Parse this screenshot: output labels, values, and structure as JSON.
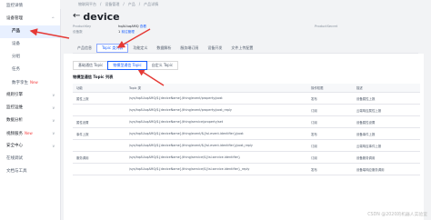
{
  "sidebar": {
    "items": [
      {
        "label": "监控详情",
        "kind": "item"
      },
      {
        "label": "设备管理",
        "kind": "group",
        "chev": "^"
      },
      {
        "label": "产品",
        "kind": "sub-active"
      },
      {
        "label": "设备",
        "kind": "sub"
      },
      {
        "label": "分组",
        "kind": "sub"
      },
      {
        "label": "任务",
        "kind": "sub"
      },
      {
        "label": "数字孪生",
        "kind": "sub",
        "badge": "New"
      },
      {
        "label": "规则引擎",
        "kind": "group",
        "chev": "v"
      },
      {
        "label": "监控运维",
        "kind": "group",
        "chev": "v"
      },
      {
        "label": "数据分析",
        "kind": "group",
        "chev": "v"
      },
      {
        "label": "视频服务",
        "kind": "group",
        "chev": "v",
        "badge": "New"
      },
      {
        "label": "安全中心",
        "kind": "group",
        "chev": "v"
      },
      {
        "label": "在线调试",
        "kind": "item"
      },
      {
        "label": "文档与工具",
        "kind": "item"
      }
    ]
  },
  "breadcrumb": [
    "物联网平台",
    "/",
    "设备管理",
    "/",
    "产品",
    "/",
    "产品详情"
  ],
  "header": {
    "back": "←",
    "title": "device"
  },
  "info": {
    "product_key_label": "ProductKey",
    "product_key_value": "",
    "product_secret_label": "ProductSecret",
    "product_secret_value": "hqAUuqAMQ",
    "product_secret_link": "查看",
    "device_count_label": "设备数",
    "device_count_value": "1",
    "device_count_link": "前往管理",
    "right_label": "ProductSecret"
  },
  "tabs": [
    "产品信息",
    "Topic 类列表",
    "功能定义",
    "数据解析",
    "服务端订阅",
    "设备开发",
    "文件上传配置"
  ],
  "active_tab": 1,
  "subtabs": [
    "基础通信 Topic",
    "物模型通信 Topic",
    "自定义 Topic"
  ],
  "active_subtab": 1,
  "list_title": "物模型通信 Topic 列表",
  "table": {
    "headers": [
      "功能",
      "Topic 类",
      "操作权限",
      "描述"
    ],
    "rows": [
      {
        "func": "属性上报",
        "topic": "/sys/hqAUuqAMQ/${deviceName}/thing/event/property/post",
        "perm": "发布",
        "desc": "设备属性上报"
      },
      {
        "func": "",
        "topic": "/sys/hqAUuqAMQ/${deviceName}/thing/event/property/post_reply",
        "perm": "订阅",
        "desc": "云端响应属性上报"
      },
      {
        "func": "属性设置",
        "topic": "/sys/hqAUuqAMQ/${deviceName}/thing/service/property/set",
        "perm": "订阅",
        "desc": "设备属性设置"
      },
      {
        "func": "事件上报",
        "topic": "/sys/hqAUuqAMQ/${deviceName}/thing/event/${tsl.event.identifier}/post",
        "perm": "发布",
        "desc": "设备事件上报"
      },
      {
        "func": "",
        "topic": "/sys/hqAUuqAMQ/${deviceName}/thing/event/${tsl.event.identifier}/post_reply",
        "perm": "订阅",
        "desc": "云端响应事件上报"
      },
      {
        "func": "服务调用",
        "topic": "/sys/hqAUuqAMQ/${deviceName}/thing/service/${tsl.service.identifier}",
        "perm": "订阅",
        "desc": "设备服务调用"
      },
      {
        "func": "",
        "topic": "/sys/hqAUuqAMQ/${deviceName}/thing/service/${tsl.service.identifier}_reply",
        "perm": "发布",
        "desc": "设备端响应服务调用"
      }
    ]
  },
  "watermark": "CSDN @2020的机器人实验室",
  "colors": {
    "accent": "#165dff",
    "annotation": "#e53935"
  }
}
